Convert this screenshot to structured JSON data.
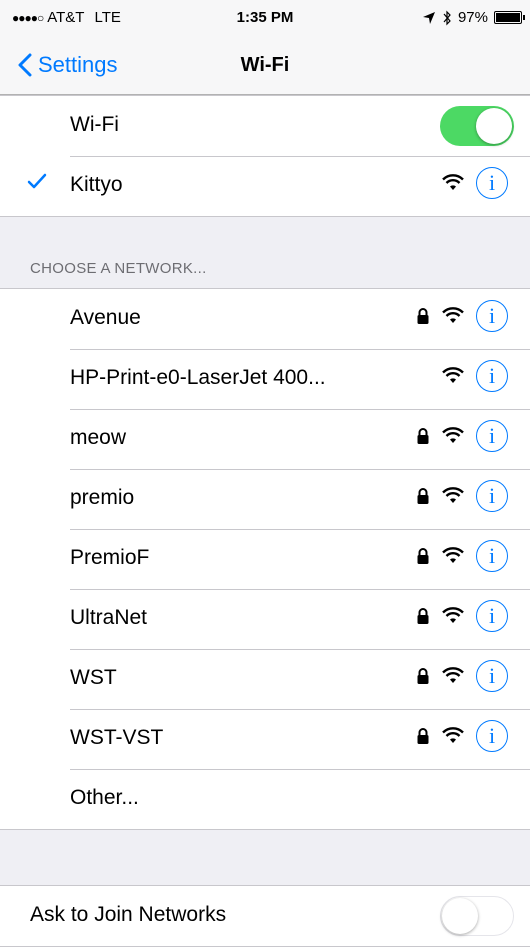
{
  "status_bar": {
    "carrier": "AT&T",
    "network": "LTE",
    "time": "1:35 PM",
    "battery": "97%"
  },
  "nav": {
    "back_label": "Settings",
    "title": "Wi-Fi"
  },
  "wifi_toggle": {
    "label": "Wi-Fi",
    "state": "on",
    "color": "#4cd964"
  },
  "connected": {
    "name": "Kittyo"
  },
  "section_header": "CHOOSE A NETWORK...",
  "networks": [
    {
      "name": "Avenue",
      "locked": true
    },
    {
      "name": "HP-Print-e0-LaserJet 400...",
      "locked": false
    },
    {
      "name": "meow",
      "locked": true
    },
    {
      "name": "premio",
      "locked": true
    },
    {
      "name": "PremioF",
      "locked": true
    },
    {
      "name": "UltraNet",
      "locked": true
    },
    {
      "name": "WST",
      "locked": true
    },
    {
      "name": "WST-VST",
      "locked": true
    }
  ],
  "other_label": "Other...",
  "ask_to_join": {
    "label": "Ask to Join Networks",
    "state": "off"
  },
  "accent_color": "#007aff"
}
